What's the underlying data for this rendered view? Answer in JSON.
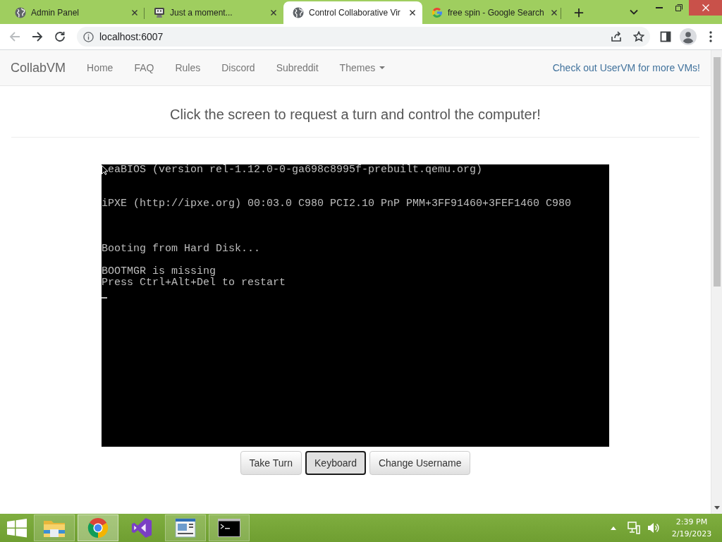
{
  "browser": {
    "tabs": [
      {
        "title": "Admin Panel",
        "selected": false
      },
      {
        "title": "Just a moment...",
        "selected": false
      },
      {
        "title": "Control Collaborative Vir",
        "selected": true
      },
      {
        "title": "free spin - Google Search",
        "selected": false
      }
    ],
    "back_disabled": true,
    "forward_disabled": false,
    "address": "localhost:6007"
  },
  "navbar": {
    "brand": "CollabVM",
    "links": [
      {
        "label": "Home",
        "dropdown": false
      },
      {
        "label": "FAQ",
        "dropdown": false
      },
      {
        "label": "Rules",
        "dropdown": false
      },
      {
        "label": "Discord",
        "dropdown": false
      },
      {
        "label": "Subreddit",
        "dropdown": false
      },
      {
        "label": "Themes",
        "dropdown": true
      }
    ],
    "right_link": "Check out UserVM for more VMs!"
  },
  "heading": "Click the screen to request a turn and control the computer!",
  "vm_screen": {
    "lines": [
      "eaBIOS (version rel-1.12.0-0-ga698c8995f-prebuilt.qemu.org)",
      "iPXE (http://ipxe.org) 00:03.0 C980 PCI2.10 PnP PMM+3FF91460+3FEF1460 C980",
      "Booting from Hard Disk...",
      "BOOTMGR is missing",
      "Press Ctrl+Alt+Del to restart"
    ],
    "mouse_pointer": true,
    "text_cursor": true
  },
  "buttons": [
    {
      "label": "Take Turn",
      "focused": false
    },
    {
      "label": "Keyboard",
      "focused": true
    },
    {
      "label": "Change Username",
      "focused": false
    }
  ],
  "taskbar": {
    "items": [
      {
        "open": true,
        "selected": false
      },
      {
        "open": true,
        "selected": true
      },
      {
        "open": false,
        "selected": false
      },
      {
        "open": true,
        "selected": false
      },
      {
        "open": true,
        "selected": false
      }
    ],
    "time": "2:39 PM",
    "date": "2/19/2023"
  }
}
